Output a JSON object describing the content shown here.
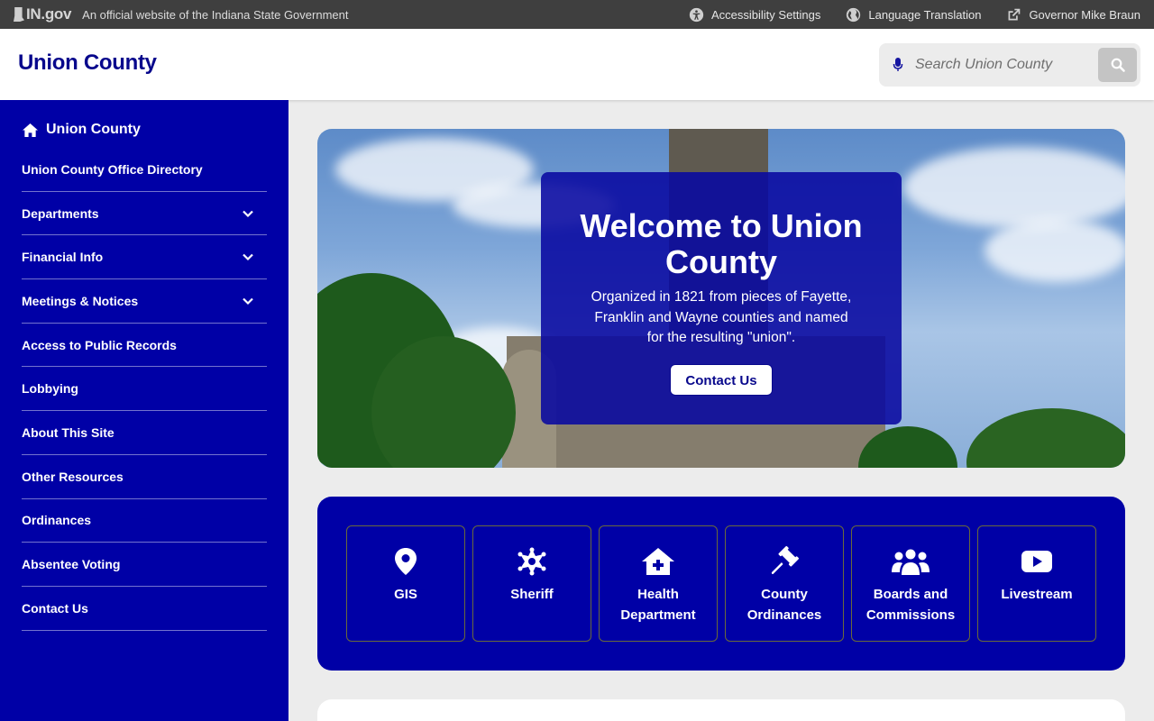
{
  "topbar": {
    "logo_text": "IN.gov",
    "official_text": "An official website of the Indiana State Government",
    "links": [
      {
        "label": "Accessibility Settings",
        "icon": "accessibility-icon"
      },
      {
        "label": "Language Translation",
        "icon": "globe-icon"
      },
      {
        "label": "Governor Mike Braun",
        "icon": "external-link-icon"
      }
    ]
  },
  "header": {
    "site_title": "Union County",
    "search_placeholder": "Search Union County"
  },
  "sidebar": {
    "home_label": "Union County",
    "items": [
      {
        "label": "Union County Office Directory",
        "expandable": false
      },
      {
        "label": "Departments",
        "expandable": true
      },
      {
        "label": "Financial Info",
        "expandable": true
      },
      {
        "label": "Meetings & Notices",
        "expandable": true
      },
      {
        "label": "Access to Public Records",
        "expandable": false
      },
      {
        "label": "Lobbying",
        "expandable": false
      },
      {
        "label": "About This Site",
        "expandable": false
      },
      {
        "label": "Other Resources",
        "expandable": false
      },
      {
        "label": "Ordinances",
        "expandable": false
      },
      {
        "label": "Absentee Voting",
        "expandable": false
      },
      {
        "label": "Contact Us",
        "expandable": false
      }
    ]
  },
  "hero": {
    "title": "Welcome to Union County",
    "description": "Organized in 1821 from pieces of Fayette, Franklin and Wayne counties and named for the resulting \"union\".",
    "button_label": "Contact Us"
  },
  "quick_links": [
    {
      "label": "GIS",
      "icon": "map-pin-icon"
    },
    {
      "label": "Sheriff",
      "icon": "sheriff-badge-icon"
    },
    {
      "label": "Health Department",
      "icon": "medical-house-icon"
    },
    {
      "label": "County Ordinances",
      "icon": "gavel-icon"
    },
    {
      "label": "Boards and Commissions",
      "icon": "people-group-icon"
    },
    {
      "label": "Livestream",
      "icon": "youtube-icon"
    }
  ],
  "colors": {
    "brand_blue": "#0000a6",
    "title_blue": "#08088c",
    "topbar": "#3f3f3f"
  }
}
